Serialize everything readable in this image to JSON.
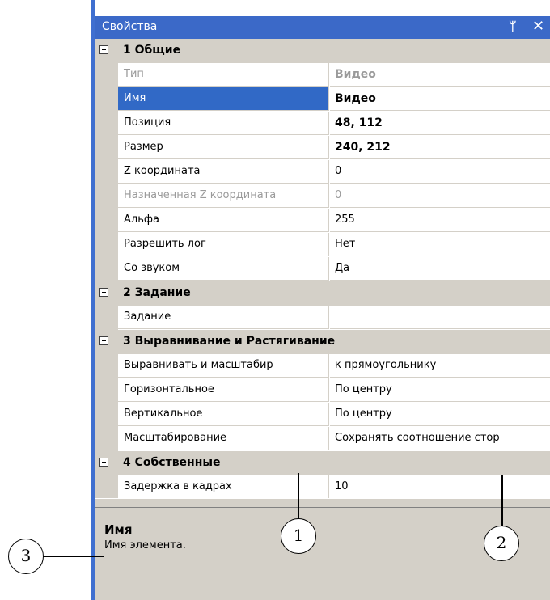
{
  "window": {
    "title": "Свойства",
    "pin_glyph": "ᛘ",
    "close_glyph": "✕"
  },
  "grid": {
    "categories": [
      {
        "label": "1 Общие",
        "props": [
          {
            "name": "Тип",
            "value": "Видео",
            "disabled": true,
            "bold": true
          },
          {
            "name": "Имя",
            "value": "Видео",
            "selected": true,
            "bold": true
          },
          {
            "name": "Позиция",
            "value": "48, 112",
            "bold": true
          },
          {
            "name": "Размер",
            "value": "240, 212",
            "bold": true
          },
          {
            "name": "Z координата",
            "value": "0"
          },
          {
            "name": "Назначенная Z координата",
            "value": "0",
            "disabled": true
          },
          {
            "name": "Альфа",
            "value": "255"
          },
          {
            "name": "Разрешить лог",
            "value": "Нет"
          },
          {
            "name": "Со звуком",
            "value": "Да"
          }
        ]
      },
      {
        "label": "2 Задание",
        "props": [
          {
            "name": "Задание",
            "value": ""
          }
        ]
      },
      {
        "label": "3 Выравнивание и Растягивание",
        "props": [
          {
            "name": "Выравнивать и масштабир",
            "value": "к прямоугольнику"
          },
          {
            "name": "Горизонтальное",
            "value": "По центру"
          },
          {
            "name": "Вертикальное",
            "value": "По центру"
          },
          {
            "name": "Масштабирование",
            "value": "Сохранять соотношение стор"
          }
        ]
      },
      {
        "label": "4 Собственные",
        "props": [
          {
            "name": "Задержка в кадрах",
            "value": "10"
          }
        ]
      }
    ]
  },
  "description": {
    "title": "Имя",
    "text": "Имя элемента."
  },
  "callouts": [
    "1",
    "2",
    "3"
  ],
  "colors": {
    "titlebar": "#3b69c8",
    "selection": "#3169c6",
    "category_bg": "#d4d0c8",
    "disabled_text": "#9a9a9a"
  }
}
